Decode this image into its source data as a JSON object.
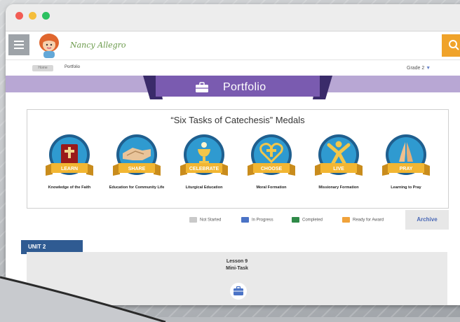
{
  "window_controls": [
    "close",
    "minimize",
    "zoom"
  ],
  "user": {
    "name": "Nancy Allegro",
    "avatar_icon": "girl-avatar-icon"
  },
  "breadcrumb": {
    "home": "Home",
    "current": "Portfolio"
  },
  "grade_selector": {
    "value": "Grade 2"
  },
  "page": {
    "title": "Portfolio",
    "title_icon": "briefcase-icon"
  },
  "medals": {
    "title": "“Six Tasks of Catechesis” Medals",
    "items": [
      {
        "badge": "LEARN",
        "caption": "Knowledge of the Faith",
        "icon": "bible-icon"
      },
      {
        "badge": "SHARE",
        "caption": "Education for Community Life",
        "icon": "handshake-icon"
      },
      {
        "badge": "CELEBRATE",
        "caption": "Liturgical Education",
        "icon": "chalice-icon"
      },
      {
        "badge": "CHOOSE",
        "caption": "Moral Formation",
        "icon": "heart-cross-icon"
      },
      {
        "badge": "LIVE",
        "caption": "Missionary Formation",
        "icon": "person-icon"
      },
      {
        "badge": "PRAY",
        "caption": "Learning to Pray",
        "icon": "praying-hands-icon"
      }
    ]
  },
  "legend": [
    {
      "label": "Not Started",
      "color": "#c9c9c9"
    },
    {
      "label": "In Progress",
      "color": "#4b73c6"
    },
    {
      "label": "Completed",
      "color": "#2f8a48"
    },
    {
      "label": "Ready for Award",
      "color": "#f0a23a"
    }
  ],
  "archive_button": "Archive",
  "unit": {
    "label": "UNIT 2"
  },
  "lesson": {
    "title": "Lesson 9",
    "subtitle": "Mini-Task",
    "icon": "briefcase-icon"
  },
  "colors": {
    "accent_purple": "#7a5bb0",
    "banner_purple": "#b8a7d4",
    "unit_blue": "#2f5b92",
    "search_orange": "#f0a32a"
  }
}
